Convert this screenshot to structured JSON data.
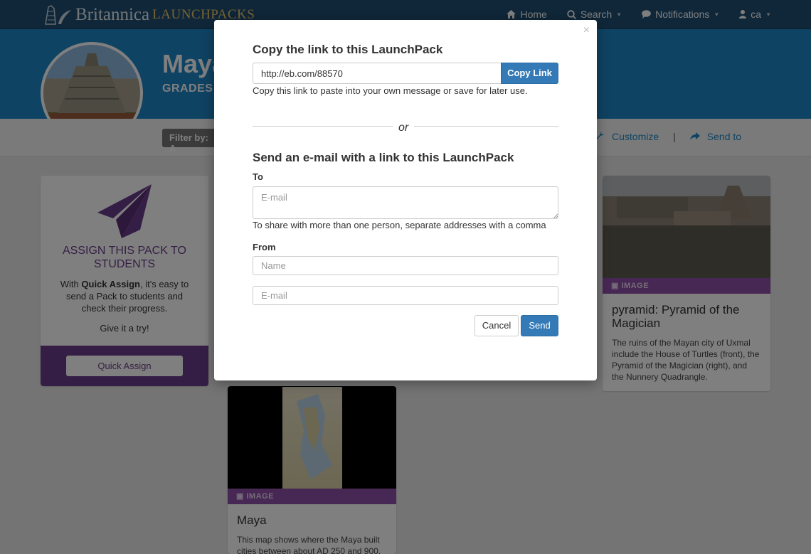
{
  "nav": {
    "brand_name": "Britannica",
    "brand_sub": "LAUNCHPACKS",
    "links": {
      "home": "Home",
      "search": "Search",
      "notifications": "Notifications",
      "user": "ca"
    }
  },
  "hero": {
    "title": "Maya",
    "grades": "GRADES K"
  },
  "toolbar": {
    "filter_label": "Filter by: A",
    "customize": "Customize",
    "send_to": "Send to"
  },
  "assign_card": {
    "title": "ASSIGN THIS PACK TO STUDENTS",
    "text_prefix": "With ",
    "text_bold": "Quick Assign",
    "text_suffix": ", it's easy to send a Pack to students and check their progress.",
    "try": "Give it a try!",
    "button": "Quick Assign"
  },
  "image_card_1": {
    "type": "IMAGE",
    "title": "pyramid: Pyramid of the Magician",
    "description": "The ruins of the Mayan city of Uxmal include the House of Turtles (front), the Pyramid of the Magician (right), and the Nunnery Quadrangle."
  },
  "image_card_2": {
    "type": "IMAGE",
    "title": "Maya",
    "description": "This map shows where the Maya built cities between about AD 250 and 900."
  },
  "modal": {
    "copy_heading": "Copy the link to this LaunchPack",
    "link_value": "http://eb.com/88570",
    "copy_button": "Copy Link",
    "copy_help": "Copy this link to paste into your own message or save for later use.",
    "or": "or",
    "email_heading": "Send an e-mail with a link to this LaunchPack",
    "to_label": "To",
    "to_placeholder": "E-mail",
    "to_help": "To share with more than one person, separate addresses with a comma",
    "from_label": "From",
    "name_placeholder": "Name",
    "email_placeholder": "E-mail",
    "cancel": "Cancel",
    "send": "Send",
    "close": "×"
  },
  "colors": {
    "nav_bg": "#1f4f73",
    "hero_bg": "#1f87c6",
    "primary_button": "#337ab7",
    "purple": "#6b3d8a",
    "image_bar": "#8e4fa6"
  }
}
